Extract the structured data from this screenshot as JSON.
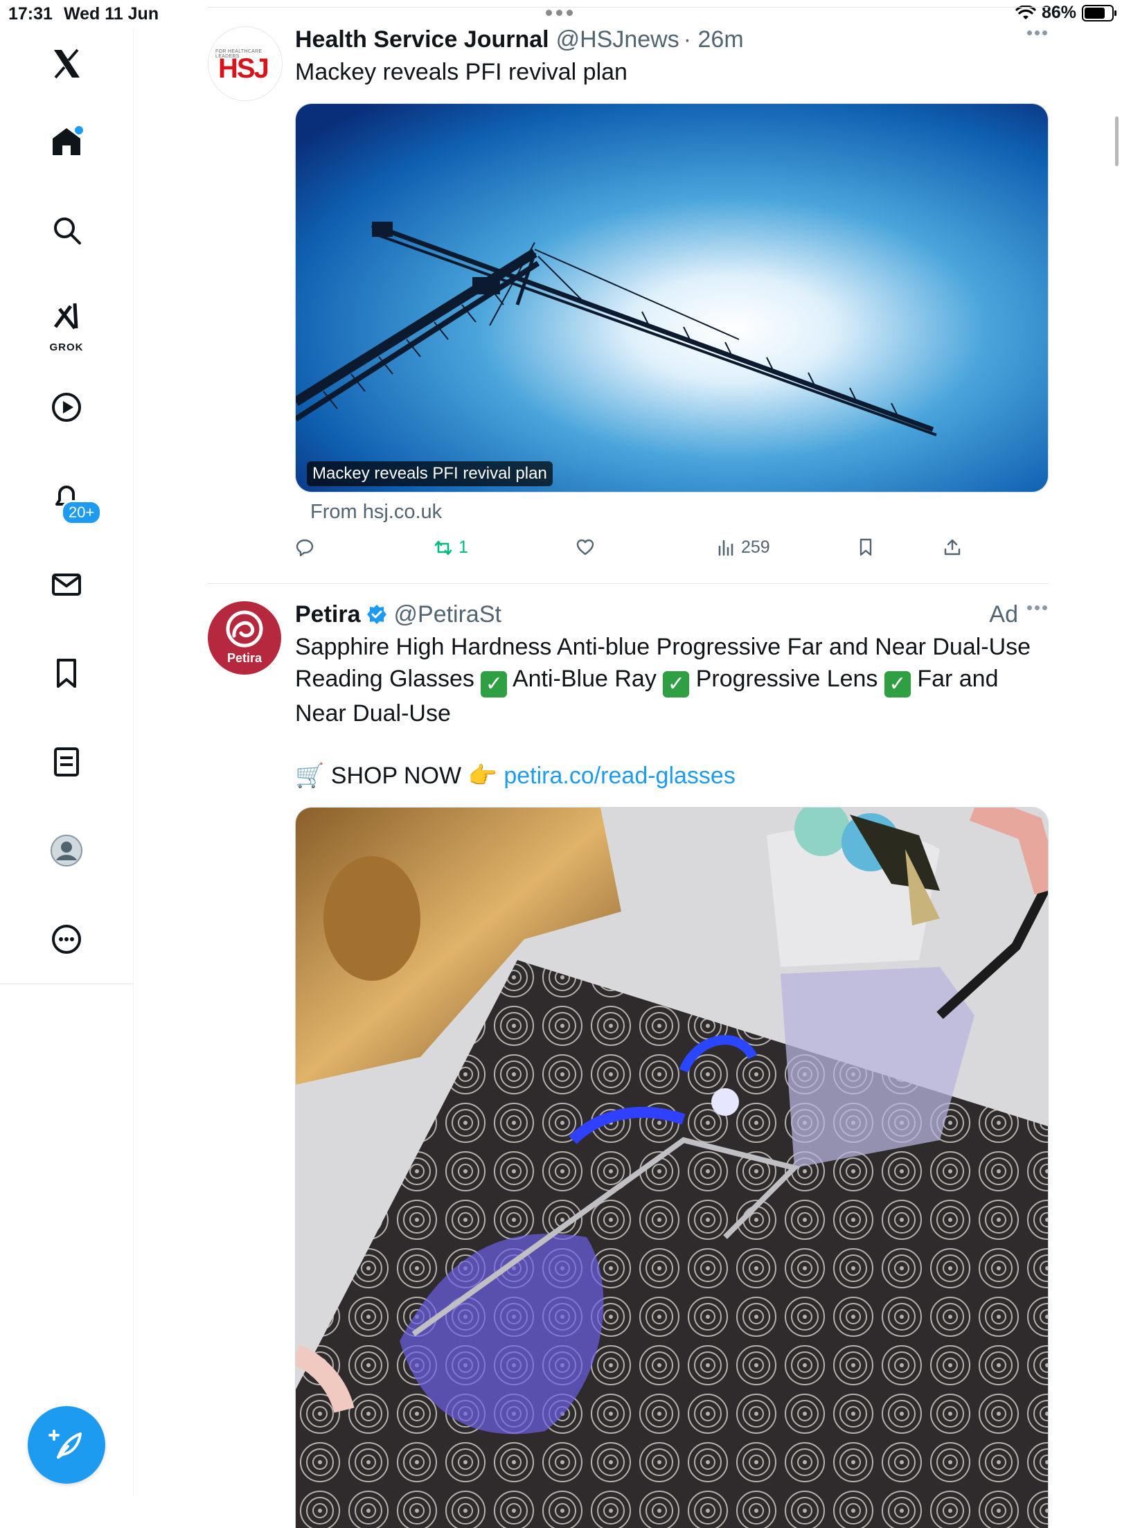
{
  "status_bar": {
    "time": "17:31",
    "date": "Wed 11 Jun",
    "battery": "86%",
    "battery_level": 0.86
  },
  "sidebar": {
    "items": [
      {
        "name": "x-logo-icon"
      },
      {
        "name": "home-icon",
        "has_unread": true
      },
      {
        "name": "search-icon"
      },
      {
        "name": "grok-icon",
        "label": "GROK"
      },
      {
        "name": "video-icon"
      },
      {
        "name": "notifications-icon",
        "badge": "20+"
      },
      {
        "name": "messages-icon"
      },
      {
        "name": "bookmarks-icon"
      },
      {
        "name": "lists-icon"
      },
      {
        "name": "profile-icon"
      },
      {
        "name": "more-icon"
      }
    ],
    "compose_icon": "compose-post-icon"
  },
  "tweets": [
    {
      "avatar_text": "HSJ",
      "avatar_subtext": "FOR HEALTHCARE LEADERS",
      "name": "Health Service Journal",
      "handle": "@HSJnews",
      "time": "· 26m",
      "text": "Mackey reveals PFI revival plan",
      "card_caption": "Mackey reveals PFI revival plan",
      "card_from": "From hsj.co.uk",
      "actions": {
        "replies": "",
        "reposts": "1",
        "likes": "",
        "views": "259"
      }
    },
    {
      "avatar_text": "Petira",
      "name": "Petira",
      "handle": "@PetiraSt",
      "ad_label": "Ad",
      "text_parts": {
        "intro": "Sapphire High Hardness Anti-blue Progressive Far and Near Dual-Use Reading Glasses",
        "feature1": "Anti-Blue Ray",
        "feature2": "Progressive Lens",
        "feature3": "Far and Near Dual-Use",
        "shop_now": "SHOP NOW",
        "link": "petira.co/read-glasses"
      },
      "check_glyph": "✓",
      "cart_emoji": "🛒",
      "point_emoji": "👉"
    }
  ],
  "colors": {
    "accent": "#1d9bf0",
    "repost_green": "#00ba7c",
    "petira_brand": "#b5283e",
    "hsj_red": "#d7141a"
  }
}
